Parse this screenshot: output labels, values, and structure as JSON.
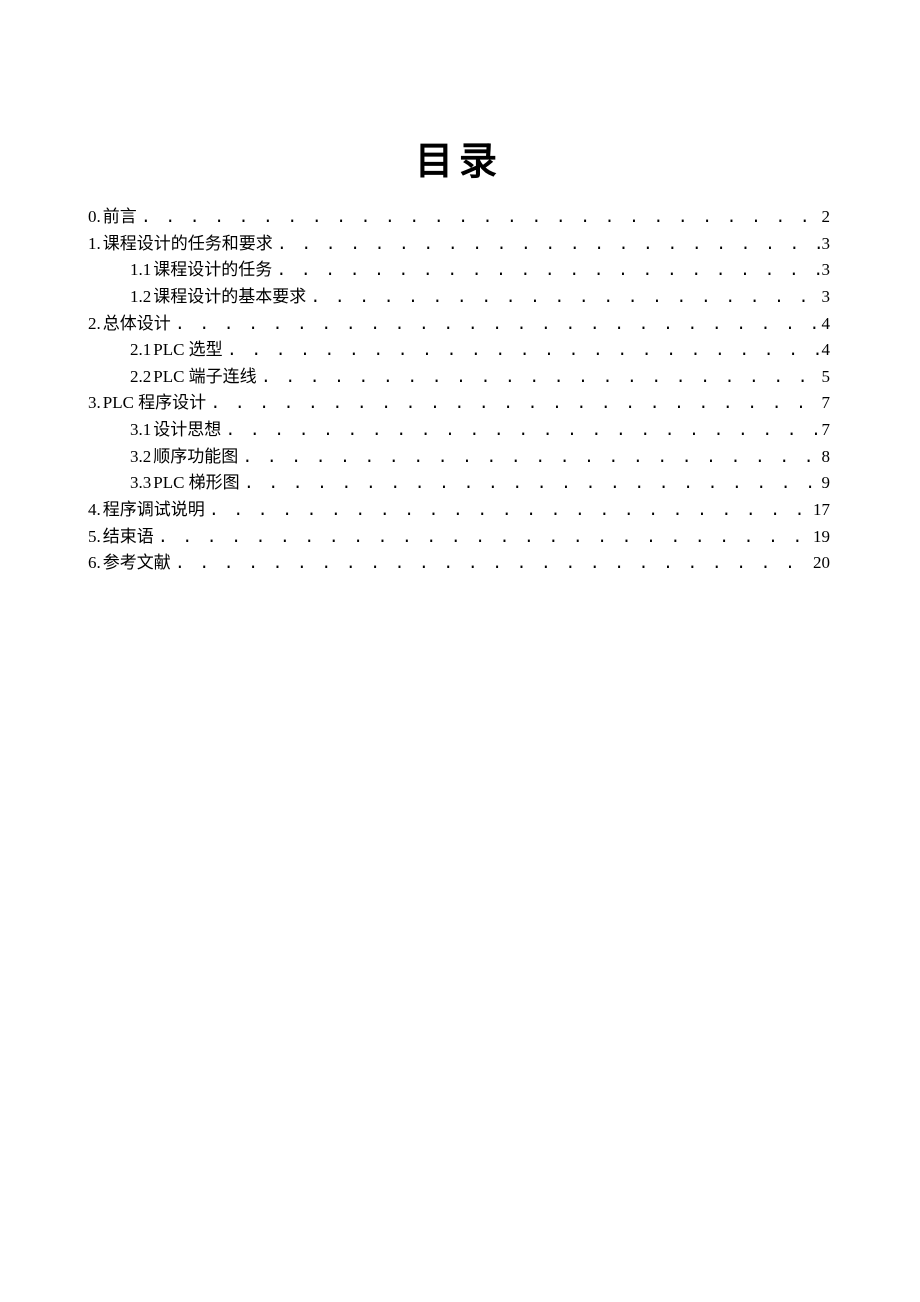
{
  "title": "目录",
  "toc": [
    {
      "level": 0,
      "marker": "0.",
      "label": "前言",
      "page": "2"
    },
    {
      "level": 0,
      "marker": "1.",
      "label": "课程设计的任务和要求",
      "page": "3"
    },
    {
      "level": 1,
      "marker": "1.1",
      "label": "课程设计的任务",
      "page": "3"
    },
    {
      "level": 1,
      "marker": "1.2",
      "label": "课程设计的基本要求",
      "page": "3"
    },
    {
      "level": 0,
      "marker": "2.",
      "label": "总体设计",
      "page": "4"
    },
    {
      "level": 1,
      "marker": "2.1",
      "label": "PLC 选型",
      "page": "4"
    },
    {
      "level": 1,
      "marker": "2.2",
      "label": "PLC 端子连线",
      "page": "5"
    },
    {
      "level": 0,
      "marker": "3.",
      "label": "PLC 程序设计",
      "page": "7"
    },
    {
      "level": 1,
      "marker": "3.1",
      "label": "设计思想",
      "page": "7"
    },
    {
      "level": 1,
      "marker": "3.2",
      "label": "顺序功能图",
      "page": "8"
    },
    {
      "level": 1,
      "marker": "3.3",
      "label": "PLC 梯形图",
      "page": "9"
    },
    {
      "level": 0,
      "marker": "4.",
      "label": "程序调试说明",
      "page": "17"
    },
    {
      "level": 0,
      "marker": "5.",
      "label": "结束语",
      "page": "19"
    },
    {
      "level": 0,
      "marker": "6.",
      "label": "参考文献",
      "page": "20"
    }
  ]
}
